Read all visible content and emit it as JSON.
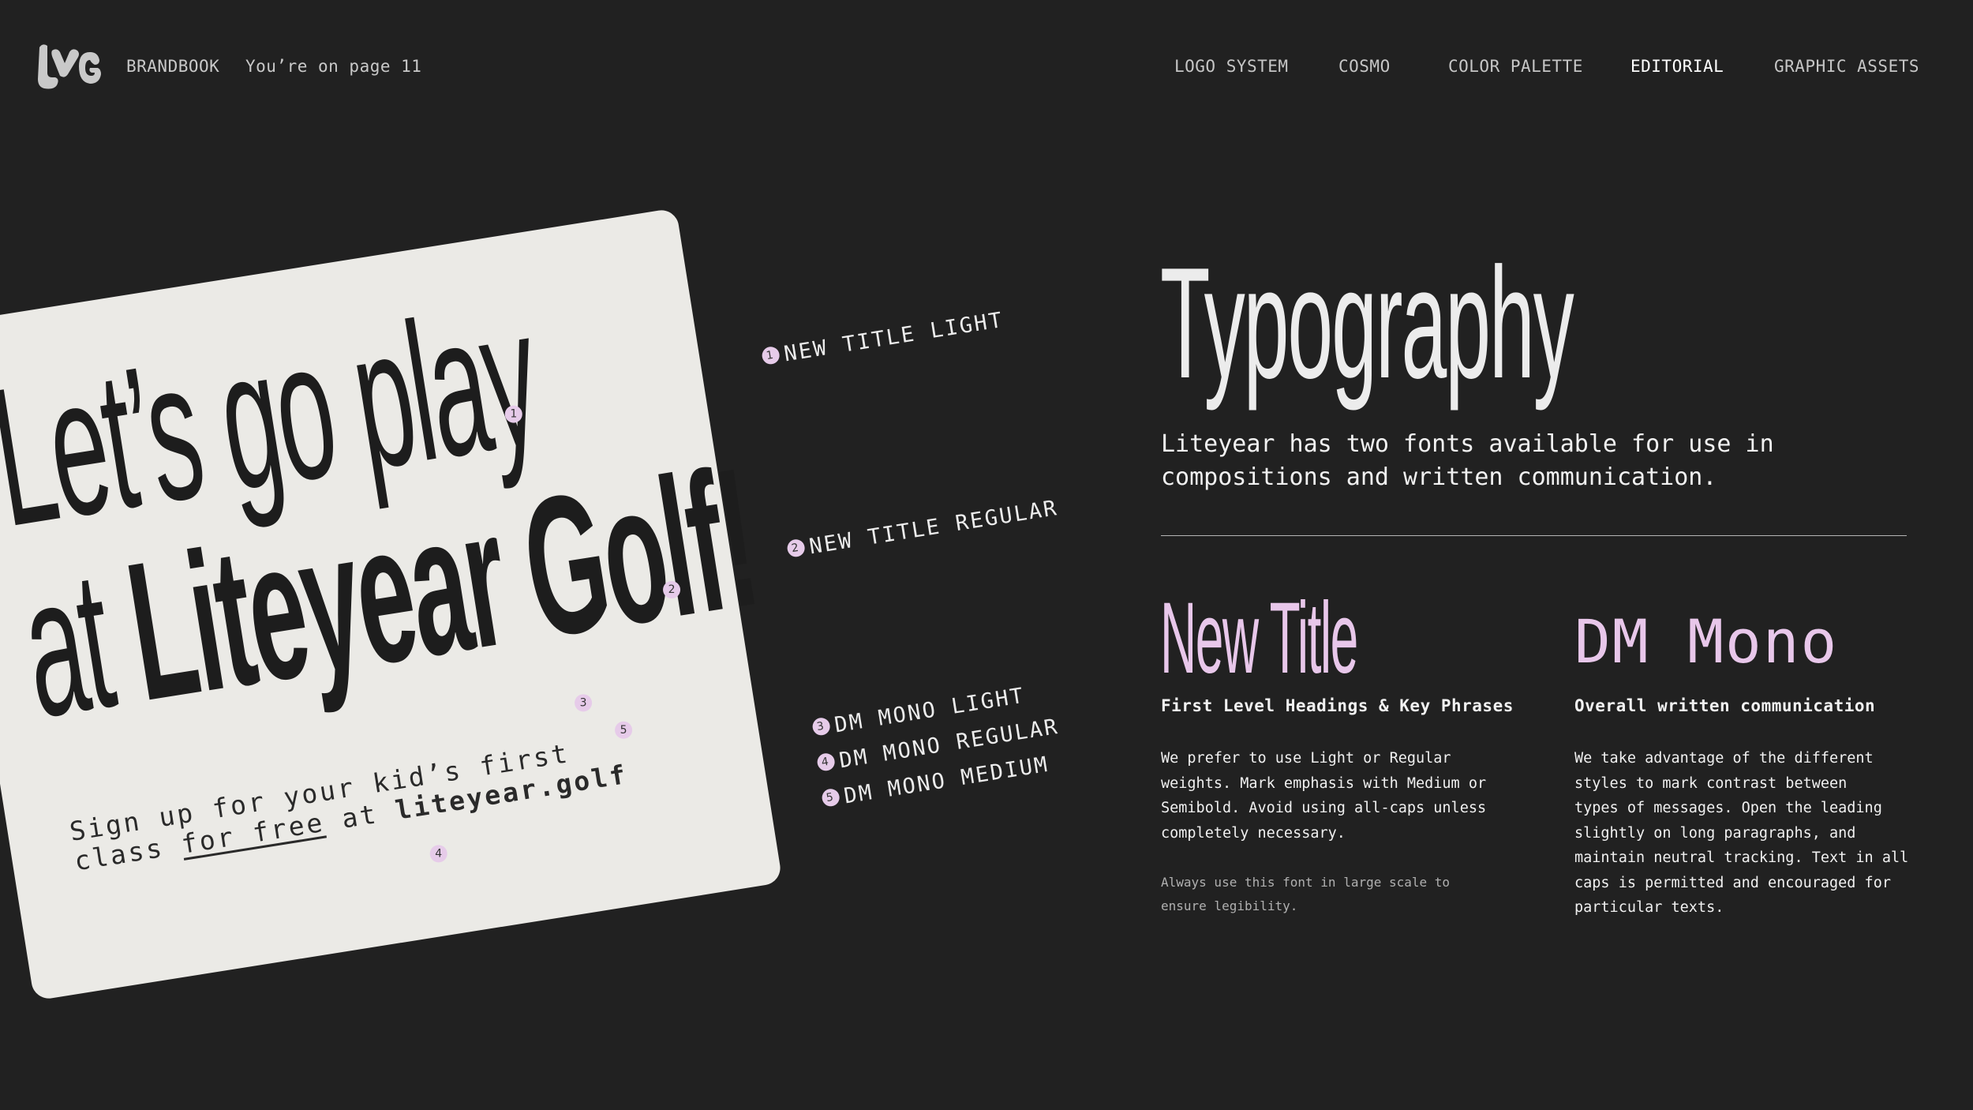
{
  "header": {
    "brandbook_label": "BRANDBOOK",
    "page_indicator": "You’re on page 11",
    "nav": [
      {
        "label": "LOGO SYSTEM"
      },
      {
        "label": "COSMO"
      },
      {
        "label": "COLOR PALETTE"
      },
      {
        "label": "EDITORIAL",
        "active": true
      },
      {
        "label": "GRAPHIC ASSETS"
      }
    ]
  },
  "card": {
    "line1": "Let’s go play",
    "line2_prefix": "at",
    "line2_brand": "Liteyear Golf!",
    "body_line1": "Sign up for your kid’s first",
    "body_prefix": "class",
    "body_free": "for free",
    "body_at": "at",
    "body_url": "liteyear.golf",
    "markers": [
      "1",
      "2",
      "3",
      "4",
      "5"
    ]
  },
  "annotations": [
    {
      "num": "1",
      "label": "NEW TITLE LIGHT"
    },
    {
      "num": "2",
      "label": "NEW TITLE REGULAR"
    },
    {
      "num": "3",
      "label": "DM MONO LIGHT"
    },
    {
      "num": "4",
      "label": "DM MONO REGULAR"
    },
    {
      "num": "5",
      "label": "DM MONO MEDIUM"
    }
  ],
  "section": {
    "title": "Typography",
    "intro": "Liteyear has two fonts available for use in compositions and written communication.",
    "fonts": [
      {
        "name": "New Title",
        "subtitle": "First Level Headings & Key Phrases",
        "body": "We prefer to use Light or Regular\nweights. Mark emphasis with Medium or\nSemibold. Avoid using all-caps unless\ncompletely necessary.",
        "note": "Always use this font in large scale to\nensure legibility."
      },
      {
        "name": "DM Mono",
        "subtitle": "Overall written communication",
        "body": "We take advantage of the different\nstyles to mark contrast between\ntypes of messages. Open the leading\nslightly on long paragraphs, and\nmaintain neutral tracking. Text in all\ncaps is permitted and encouraged for\nparticular texts."
      }
    ]
  },
  "colors": {
    "background": "#212121",
    "card": "#ebeae6",
    "accent_lilac": "#e8c7ea"
  }
}
